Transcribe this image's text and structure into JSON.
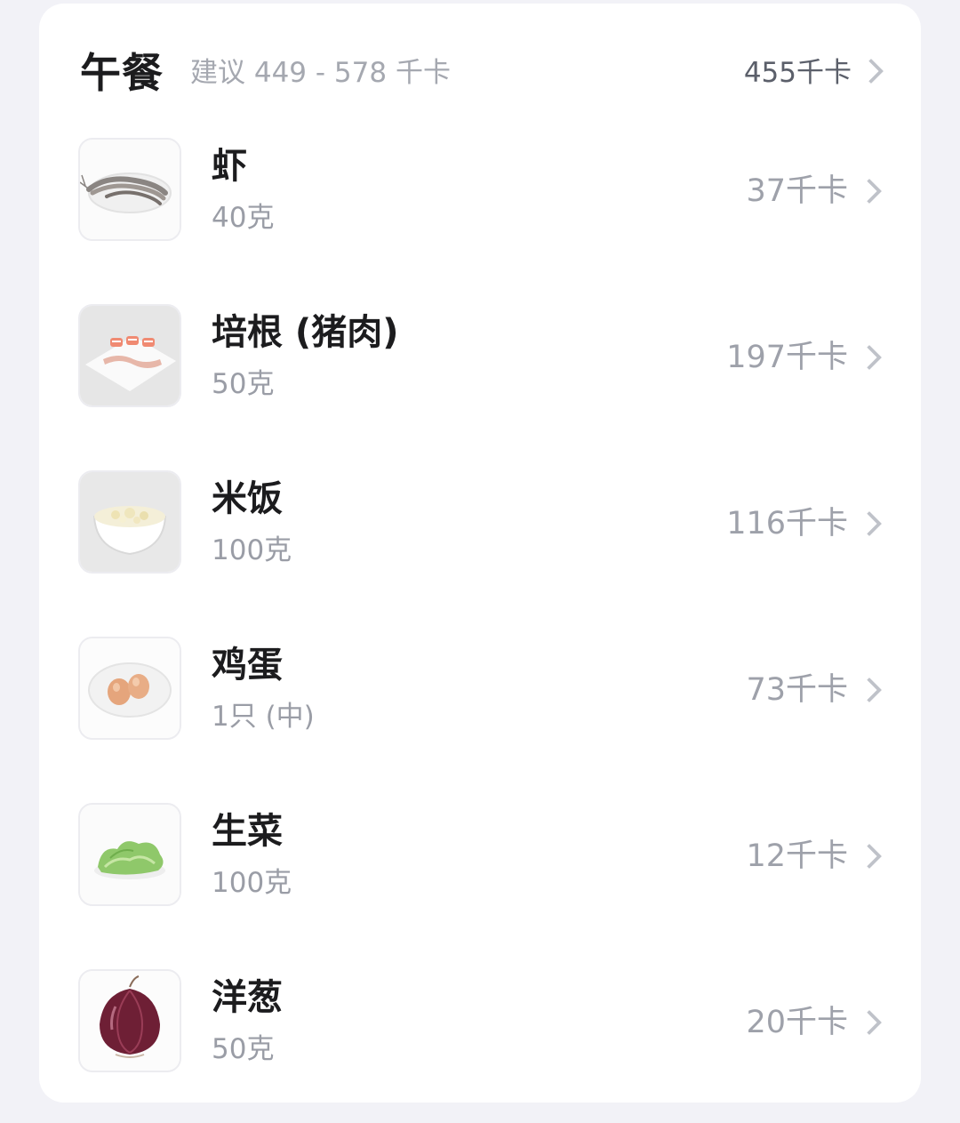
{
  "meal": {
    "title": "午餐",
    "recommendation": "建议 449 - 578 千卡",
    "total": "455千卡"
  },
  "items": [
    {
      "name": "虾",
      "amount": "40克",
      "kcal": "37千卡",
      "icon": "shrimp-image"
    },
    {
      "name": "培根 (猪肉)",
      "amount": "50克",
      "kcal": "197千卡",
      "icon": "bacon-image"
    },
    {
      "name": "米饭",
      "amount": "100克",
      "kcal": "116千卡",
      "icon": "rice-image"
    },
    {
      "name": "鸡蛋",
      "amount": "1只 (中)",
      "kcal": "73千卡",
      "icon": "egg-image"
    },
    {
      "name": "生菜",
      "amount": "100克",
      "kcal": "12千卡",
      "icon": "lettuce-image"
    },
    {
      "name": "洋葱",
      "amount": "50克",
      "kcal": "20千卡",
      "icon": "onion-image"
    }
  ]
}
